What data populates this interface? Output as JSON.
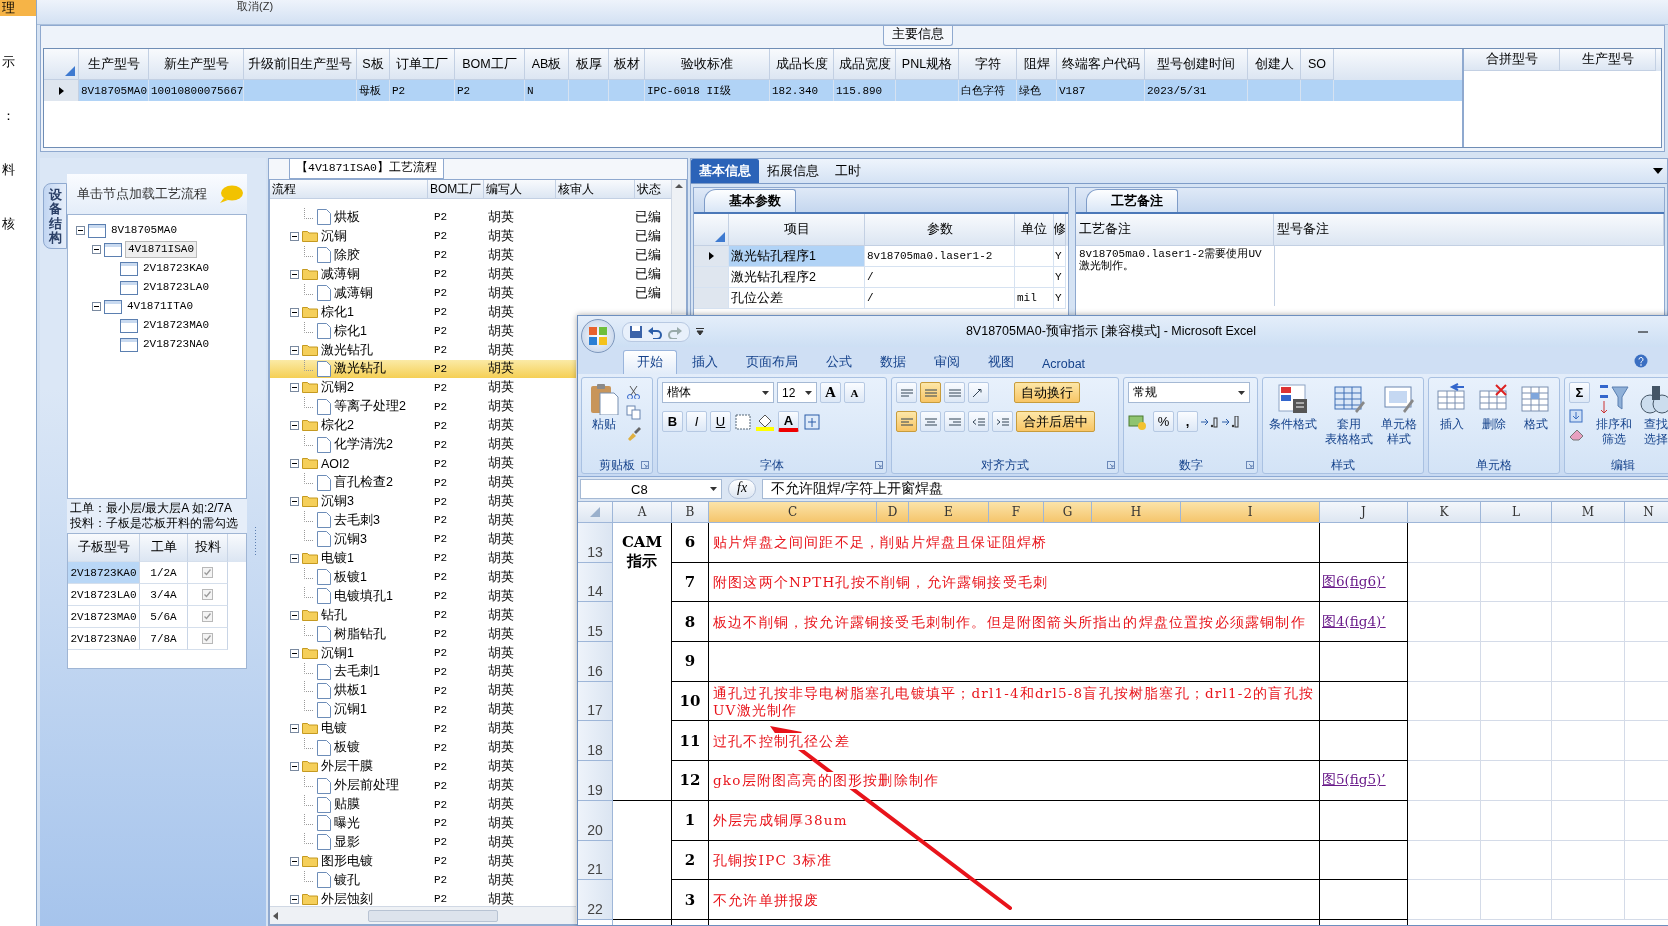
{
  "side_menu": [
    {
      "label": "理",
      "selected": true
    },
    {
      "label": "示",
      "selected": false
    },
    {
      "label": "：",
      "selected": false
    },
    {
      "label": "料",
      "selected": false
    },
    {
      "label": "核",
      "selected": false
    }
  ],
  "toolbar": {
    "cancel_button": "取消(Z)"
  },
  "main_info": {
    "title": "主要信息",
    "columns": [
      "生产型号",
      "新生产型号",
      "升级前旧生产型号",
      "S板",
      "订单工厂",
      "BOM工厂",
      "AB板",
      "板厚",
      "板材",
      "验收标准",
      "成品长度",
      "成品宽度",
      "PNL规格",
      "字符",
      "阻焊",
      "终端客户代码",
      "型号创建时间",
      "创建人",
      "SO"
    ],
    "rows": [
      {
        "selected": true,
        "cells": [
          "8V18705MA0",
          "10010800075667",
          "",
          "母板",
          "P2",
          "P2",
          "N",
          "",
          "",
          "IPC-6018 II级",
          "182.340",
          "115.890",
          "",
          "白色字符",
          "绿色",
          "V187",
          "2023/5/31",
          "",
          ""
        ]
      }
    ],
    "side_columns": [
      "合拼型号",
      "生产型号"
    ]
  },
  "structure_panel": {
    "tab": "设备结构",
    "hint": "单击节点加载工艺流程",
    "tree": [
      {
        "label": "8V18705MA0",
        "expanded": true,
        "selected": false,
        "children": [
          {
            "label": "4V1871ISA0",
            "expanded": true,
            "selected": true,
            "children": [
              {
                "label": "2V18723KA0",
                "selected": false
              },
              {
                "label": "2V18723LA0",
                "selected": false
              }
            ]
          },
          {
            "label": "4V1871ITA0",
            "expanded": true,
            "selected": false,
            "children": [
              {
                "label": "2V18723MA0",
                "selected": false
              },
              {
                "label": "2V18723NA0",
                "selected": false
              }
            ]
          }
        ]
      }
    ],
    "notes": [
      "工单：最小层/最大层A 如:2/7A",
      "投料：子板是芯板开料的需勾选"
    ],
    "board_table": {
      "columns": [
        "子板型号",
        "工单",
        "投料"
      ],
      "rows": [
        {
          "model": "2V18723KA0",
          "order": "1/2A",
          "checked": true,
          "selected": true
        },
        {
          "model": "2V18723LA0",
          "order": "3/4A",
          "checked": true,
          "selected": false
        },
        {
          "model": "2V18723MA0",
          "order": "5/6A",
          "checked": true,
          "selected": false
        },
        {
          "model": "2V18723NA0",
          "order": "7/8A",
          "checked": true,
          "selected": false
        }
      ]
    }
  },
  "flow_panel": {
    "title": "【4V1871ISA0】工艺流程",
    "columns": [
      "流程",
      "BOM工厂",
      "编写人",
      "核审人",
      "状态"
    ],
    "rows": [
      {
        "kind": "step",
        "name": "烘板",
        "bom": "P2",
        "writer": "胡英",
        "status": "已编",
        "selected": false
      },
      {
        "kind": "group",
        "name": "沉铜",
        "bom": "P2",
        "writer": "胡英",
        "status": "已编",
        "selected": false,
        "expanded": true,
        "children": [
          {
            "kind": "step",
            "name": "除胶",
            "bom": "P2",
            "writer": "胡英",
            "status": "已编",
            "selected": false
          }
        ]
      },
      {
        "kind": "group",
        "name": "减薄铜",
        "bom": "P2",
        "writer": "胡英",
        "status": "已编",
        "selected": false,
        "expanded": true,
        "children": [
          {
            "kind": "step",
            "name": "减薄铜",
            "bom": "P2",
            "writer": "胡英",
            "status": "已编",
            "selected": false
          }
        ]
      },
      {
        "kind": "group",
        "name": "棕化1",
        "bom": "P2",
        "writer": "胡英",
        "selected": false,
        "expanded": true,
        "children": [
          {
            "kind": "step",
            "name": "棕化1",
            "bom": "P2",
            "writer": "胡英",
            "selected": false
          }
        ]
      },
      {
        "kind": "group",
        "name": "激光钻孔",
        "bom": "P2",
        "writer": "胡英",
        "selected": false,
        "expanded": true,
        "children": [
          {
            "kind": "step",
            "name": "激光钻孔",
            "bom": "P2",
            "writer": "胡英",
            "selected": true
          }
        ]
      },
      {
        "kind": "group",
        "name": "沉铜2",
        "bom": "P2",
        "writer": "胡英",
        "selected": false,
        "expanded": true,
        "children": [
          {
            "kind": "step",
            "name": "等离子处理2",
            "bom": "P2",
            "writer": "胡英",
            "selected": false
          }
        ]
      },
      {
        "kind": "group",
        "name": "棕化2",
        "bom": "P2",
        "writer": "胡英",
        "selected": false,
        "expanded": true,
        "children": [
          {
            "kind": "step",
            "name": "化学清洗2",
            "bom": "P2",
            "writer": "胡英",
            "selected": false
          }
        ]
      },
      {
        "kind": "group",
        "name": "AOI2",
        "bom": "P2",
        "writer": "胡英",
        "selected": false,
        "expanded": true,
        "children": [
          {
            "kind": "step",
            "name": "盲孔检查2",
            "bom": "P2",
            "writer": "胡英",
            "selected": false
          }
        ]
      },
      {
        "kind": "group",
        "name": "沉铜3",
        "bom": "P2",
        "writer": "胡英",
        "selected": false,
        "expanded": true,
        "children": [
          {
            "kind": "step",
            "name": "去毛刺3",
            "bom": "P2",
            "writer": "胡英",
            "selected": false
          },
          {
            "kind": "step",
            "name": "沉铜3",
            "bom": "P2",
            "writer": "胡英",
            "selected": false
          }
        ]
      },
      {
        "kind": "group",
        "name": "电镀1",
        "bom": "P2",
        "writer": "胡英",
        "selected": false,
        "expanded": true,
        "children": [
          {
            "kind": "step",
            "name": "板镀1",
            "bom": "P2",
            "writer": "胡英",
            "selected": false
          },
          {
            "kind": "step",
            "name": "电镀填孔1",
            "bom": "P2",
            "writer": "胡英",
            "selected": false
          }
        ]
      },
      {
        "kind": "group",
        "name": "钻孔",
        "bom": "P2",
        "writer": "胡英",
        "selected": false,
        "expanded": true,
        "children": [
          {
            "kind": "step",
            "name": "树脂钻孔",
            "bom": "P2",
            "writer": "胡英",
            "selected": false
          }
        ]
      },
      {
        "kind": "group",
        "name": "沉铜1",
        "bom": "P2",
        "writer": "胡英",
        "selected": false,
        "expanded": true,
        "children": [
          {
            "kind": "step",
            "name": "去毛刺1",
            "bom": "P2",
            "writer": "胡英",
            "selected": false
          },
          {
            "kind": "step",
            "name": "烘板1",
            "bom": "P2",
            "writer": "胡英",
            "selected": false
          },
          {
            "kind": "step",
            "name": "沉铜1",
            "bom": "P2",
            "writer": "胡英",
            "selected": false
          }
        ]
      },
      {
        "kind": "group",
        "name": "电镀",
        "bom": "P2",
        "writer": "胡英",
        "selected": false,
        "expanded": true,
        "children": [
          {
            "kind": "step",
            "name": "板镀",
            "bom": "P2",
            "writer": "胡英",
            "selected": false
          }
        ]
      },
      {
        "kind": "group",
        "name": "外层干膜",
        "bom": "P2",
        "writer": "胡英",
        "selected": false,
        "expanded": true,
        "children": [
          {
            "kind": "step",
            "name": "外层前处理",
            "bom": "P2",
            "writer": "胡英",
            "selected": false
          },
          {
            "kind": "step",
            "name": "贴膜",
            "bom": "P2",
            "writer": "胡英",
            "selected": false
          },
          {
            "kind": "step",
            "name": "曝光",
            "bom": "P2",
            "writer": "胡英",
            "selected": false
          },
          {
            "kind": "step",
            "name": "显影",
            "bom": "P2",
            "writer": "胡英",
            "selected": false
          }
        ]
      },
      {
        "kind": "group",
        "name": "图形电镀",
        "bom": "P2",
        "writer": "胡英",
        "selected": false,
        "expanded": true,
        "children": [
          {
            "kind": "step",
            "name": "镀孔",
            "bom": "P2",
            "writer": "胡英",
            "selected": false
          }
        ]
      },
      {
        "kind": "group",
        "name": "外层蚀刻",
        "bom": "P2",
        "writer": "胡英",
        "selected": false,
        "expanded": true
      }
    ]
  },
  "detail_panel": {
    "tabs": [
      {
        "label": "基本信息",
        "selected": true
      },
      {
        "label": "拓展信息",
        "selected": false
      },
      {
        "label": "工时",
        "selected": false
      }
    ],
    "params": {
      "title": "基本参数",
      "columns": [
        "项目",
        "参数",
        "单位",
        "修"
      ],
      "rows": [
        {
          "item": "激光钻孔程序1",
          "value": "8v18705ma0.laser1-2",
          "unit": "",
          "flag": "Y",
          "selected": true
        },
        {
          "item": "激光钻孔程序2",
          "value": "/",
          "unit": "",
          "flag": "Y",
          "selected": false
        },
        {
          "item": "孔位公差",
          "value": "/",
          "unit": "mil",
          "flag": "Y",
          "selected": false
        }
      ]
    },
    "remarks": {
      "title": "工艺备注",
      "columns": [
        "工艺备注",
        "型号备注"
      ],
      "text": "8v18705ma0.laser1-2需要使用UV激光制作。"
    }
  },
  "excel": {
    "title": "8V18705MA0-预审指示  [兼容模式] - Microsoft Excel",
    "tabs": [
      {
        "label": "开始",
        "selected": true
      },
      {
        "label": "插入",
        "selected": false
      },
      {
        "label": "页面布局",
        "selected": false
      },
      {
        "label": "公式",
        "selected": false
      },
      {
        "label": "数据",
        "selected": false
      },
      {
        "label": "审阅",
        "selected": false
      },
      {
        "label": "视图",
        "selected": false
      },
      {
        "label": "Acrobat",
        "selected": false
      }
    ],
    "ribbon": [
      {
        "kind": "clipboard",
        "label": "剪贴板",
        "paste": "粘贴"
      },
      {
        "kind": "font",
        "label": "字体",
        "font": "楷体",
        "size": "12",
        "grow_button": "A",
        "shrink_button": "A",
        "styles": [
          "B",
          "I",
          "U"
        ],
        "font_color_button": "A"
      },
      {
        "kind": "alignment",
        "label": "对齐方式",
        "aligns": [
          {
            "kind": "top",
            "on": false
          },
          {
            "kind": "middle",
            "on": true
          },
          {
            "kind": "bottom",
            "on": false
          },
          {
            "kind": "orient",
            "on": false
          },
          {
            "kind": "left",
            "on": true
          },
          {
            "kind": "center",
            "on": false
          },
          {
            "kind": "right",
            "on": false
          },
          {
            "kind": "outdent",
            "on": false
          },
          {
            "kind": "indent",
            "on": false
          }
        ],
        "wrap": {
          "label": "自动换行",
          "on": true
        },
        "merge": {
          "label": "合并后居中",
          "on": true
        }
      },
      {
        "kind": "number",
        "label": "数字",
        "format": "常规",
        "percent": "%",
        "comma": ","
      },
      {
        "kind": "styles",
        "label": "样式",
        "buttons": [
          {
            "kind": "conditional",
            "lines": [
              "条件格式"
            ]
          },
          {
            "kind": "table",
            "lines": [
              "套用",
              "表格格式"
            ]
          },
          {
            "kind": "cellstyle",
            "lines": [
              "单元格",
              "样式"
            ]
          }
        ]
      },
      {
        "kind": "cells",
        "label": "单元格",
        "buttons": [
          {
            "kind": "insert",
            "lines": [
              "插入"
            ]
          },
          {
            "kind": "delete",
            "lines": [
              "删除"
            ]
          },
          {
            "kind": "format",
            "lines": [
              "格式"
            ]
          }
        ]
      },
      {
        "kind": "editing",
        "label": "编辑",
        "sum": "Σ",
        "buttons": [
          {
            "kind": "sort",
            "lines": [
              "排序和",
              "筛选"
            ]
          },
          {
            "kind": "find",
            "lines": [
              "查找",
              "选择"
            ]
          }
        ]
      }
    ],
    "formula_bar": {
      "name_box": "C8",
      "function_label": "fx",
      "value": "不允许阻焊/字符上开窗焊盘"
    },
    "columns": [
      {
        "label": "A",
        "selected": false
      },
      {
        "label": "B",
        "selected": false
      },
      {
        "label": "C",
        "selected": true
      },
      {
        "label": "D",
        "selected": true
      },
      {
        "label": "E",
        "selected": true
      },
      {
        "label": "F",
        "selected": true
      },
      {
        "label": "G",
        "selected": true
      },
      {
        "label": "H",
        "selected": true
      },
      {
        "label": "I",
        "selected": true
      },
      {
        "label": "J",
        "selected": false
      },
      {
        "label": "K",
        "selected": false
      },
      {
        "label": "L",
        "selected": false
      },
      {
        "label": "M",
        "selected": false
      },
      {
        "label": "N",
        "selected": false
      }
    ],
    "sections": [
      {
        "label": [
          "CAM",
          "指示"
        ],
        "rows": [
          {
            "row": "13",
            "number": "6",
            "text": "贴片焊盘之间间距不足，削贴片焊盘且保证阻焊桥"
          },
          {
            "row": "14",
            "number": "7",
            "text": "附图这两个NPTH孔按不削铜，允许露铜接受毛刺",
            "link": "图6(fig6)’"
          },
          {
            "row": "15",
            "number": "8",
            "text": "板边不削铜，按允许露铜接受毛刺制作。但是附图箭头所指出的焊盘位置按必须露铜制作",
            "link": "图4(fig4)’"
          },
          {
            "row": "16",
            "number": "9"
          },
          {
            "row": "17",
            "number": "10",
            "text": "通孔过孔按非导电树脂塞孔电镀填平；drl1-4和drl5-8盲孔按树脂塞孔；drl1-2的盲孔按UV激光制作"
          },
          {
            "row": "18",
            "number": "11",
            "text": "过孔不控制孔径公差"
          },
          {
            "row": "19",
            "number": "12",
            "text": "gko层附图高亮的图形按删除制作",
            "link": "图5(fig5)’"
          }
        ]
      },
      {
        "rows": [
          {
            "row": "20",
            "number": "1",
            "text": "外层完成铜厚38um"
          },
          {
            "row": "21",
            "number": "2",
            "text": "孔铜按IPC 3标准"
          },
          {
            "row": "22",
            "number": "3",
            "text": "不允许单拼报废"
          }
        ]
      }
    ]
  }
}
